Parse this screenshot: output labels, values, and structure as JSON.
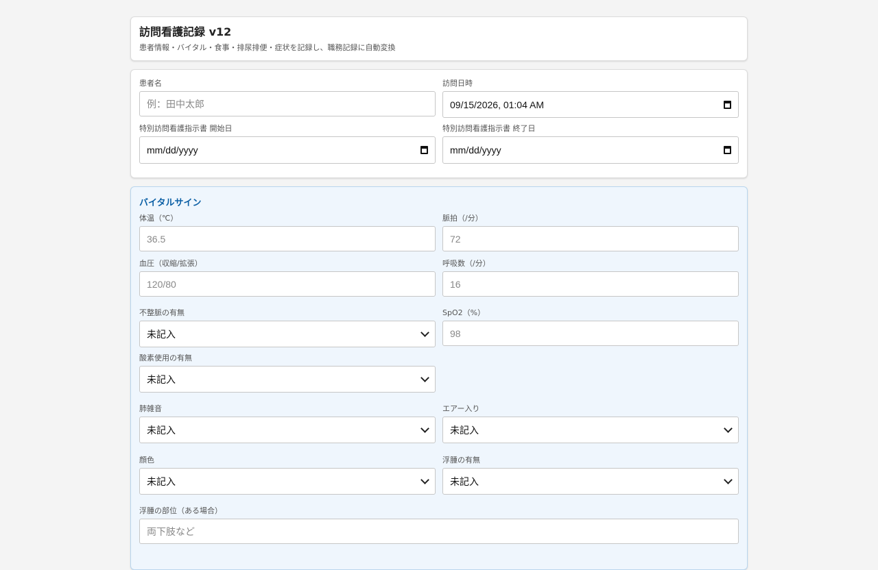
{
  "header": {
    "title": "訪問看護記録 v12",
    "subtitle": "患者情報・バイタル・食事・排尿排便・症状を記録し、職務記録に自動変換"
  },
  "patient": {
    "name_label": "患者名",
    "name_placeholder": "例：田中太郎",
    "visit_label": "訪問日時",
    "visit_value": "09/15/2026, 01:04 AM",
    "start_label": "特別訪問看護指示書 開始日",
    "start_value": "mm/dd/yyyy",
    "end_label": "特別訪問看護指示書 終了日",
    "end_value": "mm/dd/yyyy"
  },
  "vitals": {
    "section_title": "バイタルサイン",
    "temp_label": "体温（℃）",
    "temp_placeholder": "36.5",
    "pulse_label": "脈拍（/分）",
    "pulse_placeholder": "72",
    "bp_label": "血圧（収縮/拡張）",
    "bp_placeholder": "120/80",
    "resp_label": "呼吸数（/分）",
    "resp_placeholder": "16",
    "arrhythmia_label": "不整脈の有無",
    "arrhythmia_value": "未記入",
    "spo2_label": "SpO2（%）",
    "spo2_placeholder": "98",
    "oxygen_label": "酸素使用の有無",
    "oxygen_value": "未記入",
    "lung_label": "肺雑音",
    "lung_value": "未記入",
    "air_label": "エアー入り",
    "air_value": "未記入",
    "complexion_label": "顔色",
    "complexion_value": "未記入",
    "edema_label": "浮腫の有無",
    "edema_value": "未記入",
    "edema_site_label": "浮腫の部位（ある場合）",
    "edema_site_placeholder": "両下肢など"
  },
  "icons": {
    "calendar": "calendar-icon",
    "select": "chevron-down-icon"
  }
}
